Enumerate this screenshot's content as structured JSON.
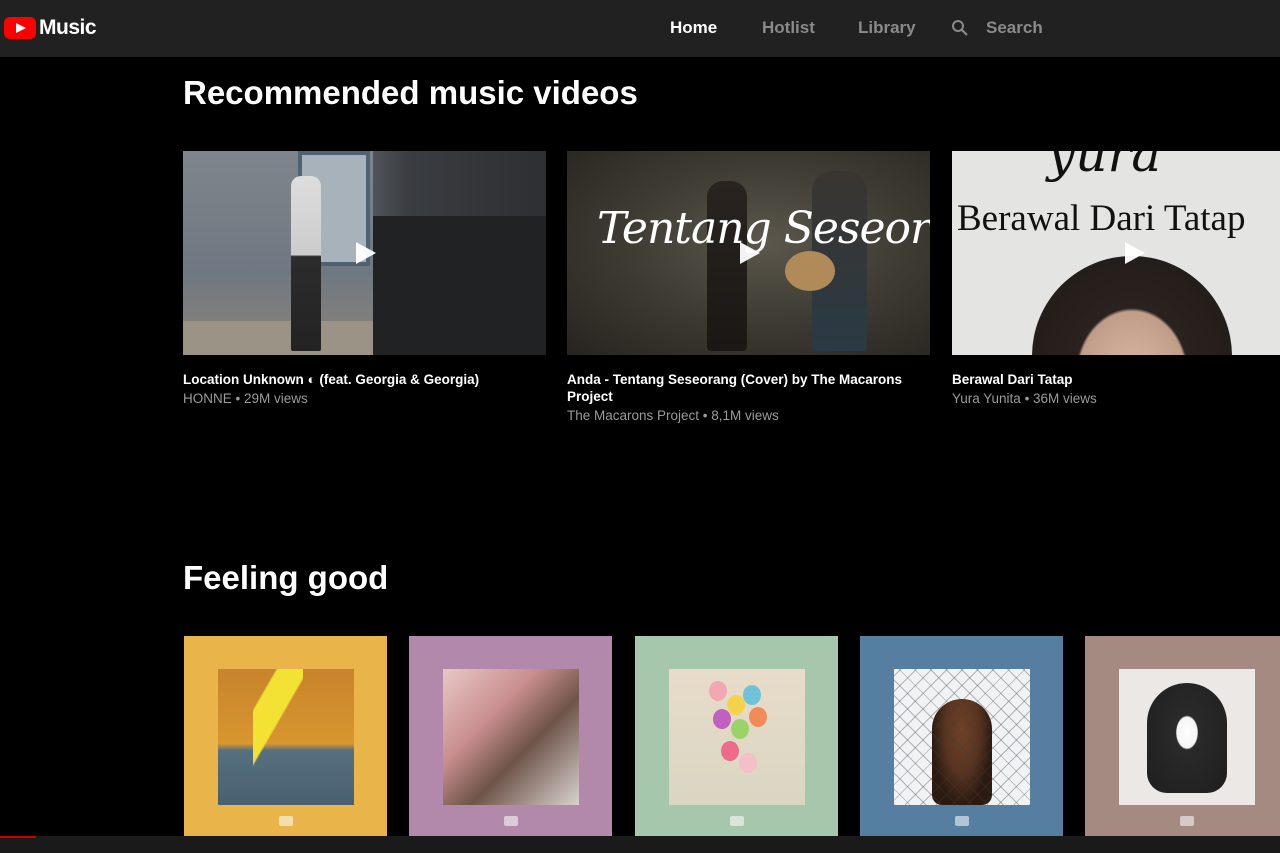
{
  "app": {
    "name": "Music",
    "brand_color": "#ff0000"
  },
  "nav": {
    "home": "Home",
    "hotlist": "Hotlist",
    "library": "Library",
    "search": "Search"
  },
  "sections": {
    "recommended": {
      "title": "Recommended music videos",
      "videos": [
        {
          "title": "Location Unknown ◐ (feat. Georgia & Georgia)",
          "meta": "HONNE • 29M views",
          "thumb_icon": "play-icon"
        },
        {
          "title": "Anda - Tentang Seseorang (Cover) by The Macarons Project",
          "meta": "The Macarons Project • 8,1M views",
          "thumb_text": "Tentang Seseorang",
          "thumb_icon": "play-icon"
        },
        {
          "title": "Berawal Dari Tatap",
          "meta": "Yura Yunita • 36M views",
          "thumb_text_top": "yura",
          "thumb_text": "Berawal Dari Tatap",
          "thumb_icon": "play-icon"
        }
      ]
    },
    "feeling_good": {
      "title": "Feeling good",
      "playlists": [
        {
          "accent": "#e9b54a"
        },
        {
          "accent": "#b389ab"
        },
        {
          "accent": "#a6c7ab"
        },
        {
          "accent": "#557ea0"
        },
        {
          "accent": "#a58a82"
        }
      ]
    }
  }
}
